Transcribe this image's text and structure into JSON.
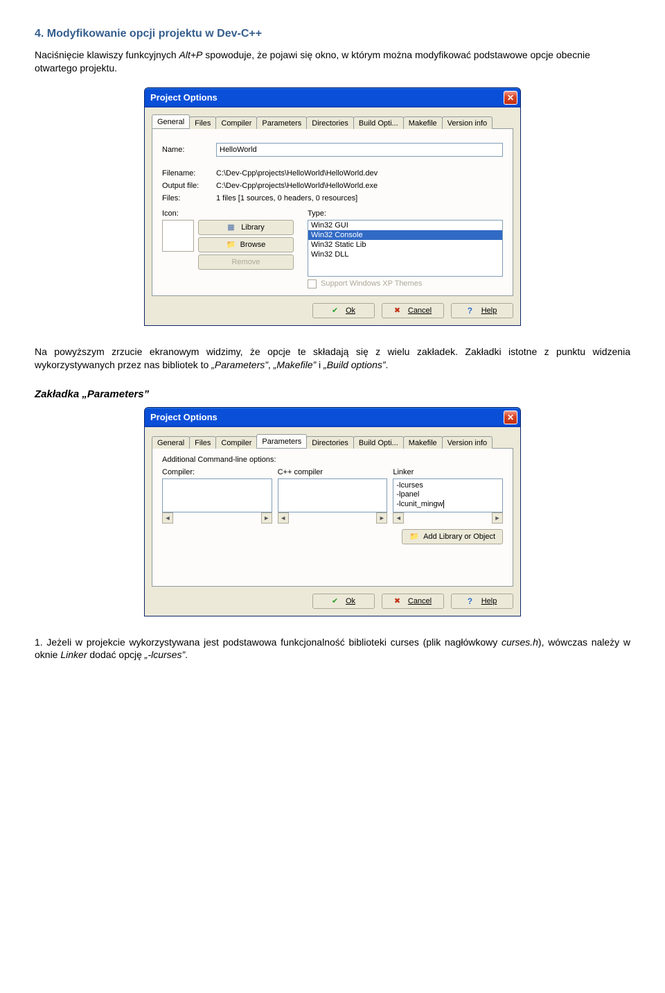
{
  "doc": {
    "heading": "4. Modyfikowanie opcji projektu w Dev-C++",
    "intro_a": "Naciśnięcie klawiszy funkcyjnych ",
    "intro_key": "Alt+P",
    "intro_b": " spowoduje, że pojawi się okno, w którym można modyfikować podstawowe opcje obecnie otwartego projektu.",
    "middle_a": "Na powyższym zrzucie ekranowym widzimy, że opcje te składają się z wielu zakładek. Zakładki istotne z punktu widzenia wykorzystywanych przez nas bibliotek to ",
    "middle_q1": "„Parameters”",
    "middle_q2": "„Makefile”",
    "middle_q3": "„Build options”",
    "middle_sep": ", ",
    "middle_sep2": " i ",
    "middle_end": ".",
    "section_params": "Zakładka „Parameters”",
    "foot_a": "1. Jeżeli w projekcie wykorzystywana jest podstawowa funkcjonalność biblioteki curses (plik nagłówkowy ",
    "foot_file": "curses.h",
    "foot_b": "), wówczas należy w oknie ",
    "foot_linker": "Linker",
    "foot_c": " dodać opcję ",
    "foot_opt": "„-lcurses”",
    "foot_d": "."
  },
  "dialog": {
    "title": "Project Options",
    "tabs": [
      "General",
      "Files",
      "Compiler",
      "Parameters",
      "Directories",
      "Build Opti...",
      "Makefile",
      "Version info"
    ],
    "general": {
      "name_label": "Name:",
      "name_value": "HelloWorld",
      "filename_label": "Filename:",
      "filename_value": "C:\\Dev-Cpp\\projects\\HelloWorld\\HelloWorld.dev",
      "output_label": "Output file:",
      "output_value": "C:\\Dev-Cpp\\projects\\HelloWorld\\HelloWorld.exe",
      "files_label": "Files:",
      "files_value": "1 files [1 sources, 0 headers, 0 resources]",
      "icon_label": "Icon:",
      "library_btn": "Library",
      "browse_btn": "Browse",
      "remove_btn": "Remove",
      "type_label": "Type:",
      "type_options": [
        "Win32 GUI",
        "Win32 Console",
        "Win32 Static Lib",
        "Win32 DLL"
      ],
      "type_selected": "Win32 Console",
      "xp_themes": "Support Windows XP Themes"
    },
    "parameters": {
      "addl_label": "Additional Command-line options:",
      "compiler_label": "Compiler:",
      "cpp_label": "C++ compiler",
      "linker_label": "Linker",
      "linker_lines": [
        "-lcurses",
        "-lpanel",
        "-lcunit_mingw"
      ],
      "addlib_btn": "Add Library or Object"
    },
    "buttons": {
      "ok": "Ok",
      "cancel": "Cancel",
      "help": "Help"
    }
  }
}
